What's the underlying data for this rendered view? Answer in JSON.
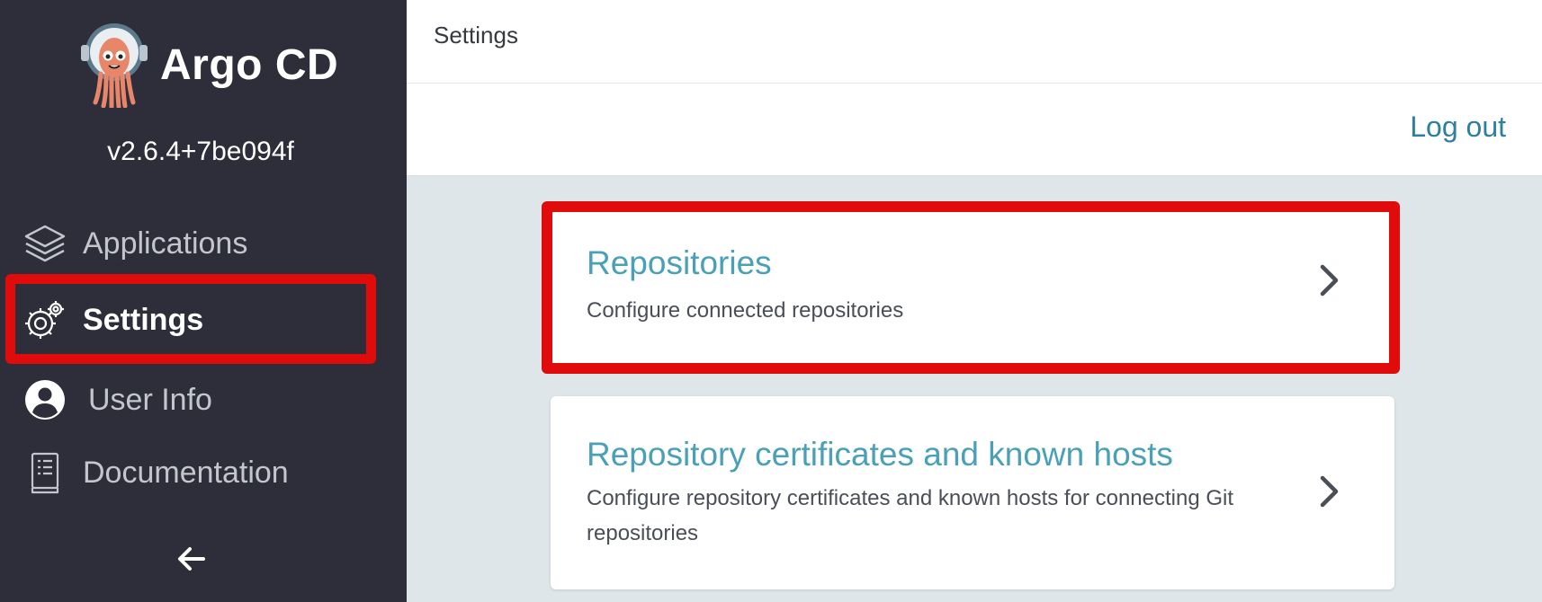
{
  "app": {
    "name": "Argo CD",
    "version": "v2.6.4+7be094f"
  },
  "sidebar": {
    "items": [
      {
        "label": "Applications",
        "icon": "layers-icon",
        "active": false
      },
      {
        "label": "Settings",
        "icon": "gears-icon",
        "active": true
      },
      {
        "label": "User Info",
        "icon": "user-circle-icon",
        "active": false
      },
      {
        "label": "Documentation",
        "icon": "book-icon",
        "active": false
      }
    ],
    "collapse_icon": "arrow-left-icon"
  },
  "header": {
    "title": "Settings"
  },
  "toolbar": {
    "logout_label": "Log out"
  },
  "cards": [
    {
      "title": "Repositories",
      "description": "Configure connected repositories",
      "icon": "chevron-right-icon"
    },
    {
      "title": "Repository certificates and known hosts",
      "description": "Configure repository certificates and known hosts for connecting Git repositories",
      "icon": "chevron-right-icon"
    }
  ],
  "colors": {
    "sidebar_bg": "#2e2e3a",
    "main_bg": "#dee6ea",
    "accent": "#4aa0b6",
    "link": "#2f7f9e",
    "highlight": "#e00b0b"
  }
}
